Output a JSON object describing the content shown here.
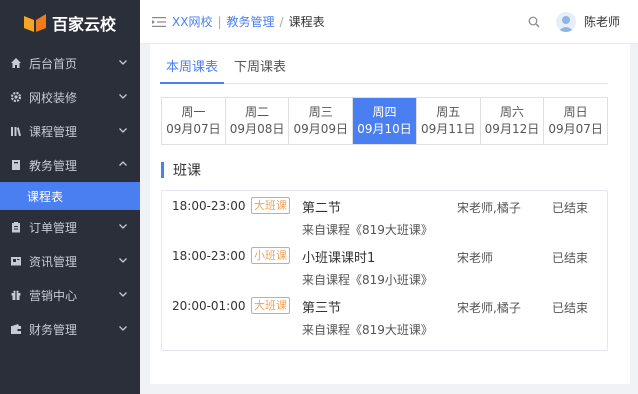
{
  "brand": {
    "name": "百家云校"
  },
  "sidebar": {
    "items": [
      {
        "label": "后台首页",
        "icon": "home-icon"
      },
      {
        "label": "网校装修",
        "icon": "gear-icon"
      },
      {
        "label": "课程管理",
        "icon": "books-icon"
      },
      {
        "label": "教务管理",
        "icon": "book-icon",
        "expanded": true
      },
      {
        "label": "订单管理",
        "icon": "clipboard-icon"
      },
      {
        "label": "资讯管理",
        "icon": "news-icon"
      },
      {
        "label": "营销中心",
        "icon": "gift-icon"
      },
      {
        "label": "财务管理",
        "icon": "wallet-icon"
      }
    ],
    "sub_items": [
      {
        "label": "课程表"
      }
    ]
  },
  "breadcrumb": [
    "XX网校",
    "教务管理",
    "课程表"
  ],
  "user": {
    "name": "陈老师"
  },
  "tabs": [
    {
      "label": "本周课表",
      "active": true
    },
    {
      "label": "下周课表",
      "active": false
    }
  ],
  "days": [
    {
      "weekday": "周一",
      "date": "09月07日",
      "active": false
    },
    {
      "weekday": "周二",
      "date": "09月08日",
      "active": false
    },
    {
      "weekday": "周三",
      "date": "09月09日",
      "active": false
    },
    {
      "weekday": "周四",
      "date": "09月10日",
      "active": true
    },
    {
      "weekday": "周五",
      "date": "09月11日",
      "active": false
    },
    {
      "weekday": "周六",
      "date": "09月12日",
      "active": false
    },
    {
      "weekday": "周日",
      "date": "09月07日",
      "active": false
    }
  ],
  "section": {
    "title": "班课"
  },
  "lessons": [
    {
      "time": "18:00-23:00",
      "badge": "大班课",
      "title": "第二节",
      "from": "来自课程《819大班课》",
      "teacher": "宋老师,橘子",
      "status": "已结束"
    },
    {
      "time": "18:00-23:00",
      "badge": "小班课",
      "title": "小班课课时1",
      "from": "来自课程《819小班课》",
      "teacher": "宋老师",
      "status": "已结束"
    },
    {
      "time": "20:00-01:00",
      "badge": "大班课",
      "title": "第三节",
      "from": "来自课程《819大班课》",
      "teacher": "宋老师,橘子",
      "status": "已结束"
    }
  ],
  "colors": {
    "accent": "#4a7ff2",
    "sidebar_bg": "#2b2f3a",
    "badge": "#f0a35a",
    "logo": "#f5a623"
  }
}
